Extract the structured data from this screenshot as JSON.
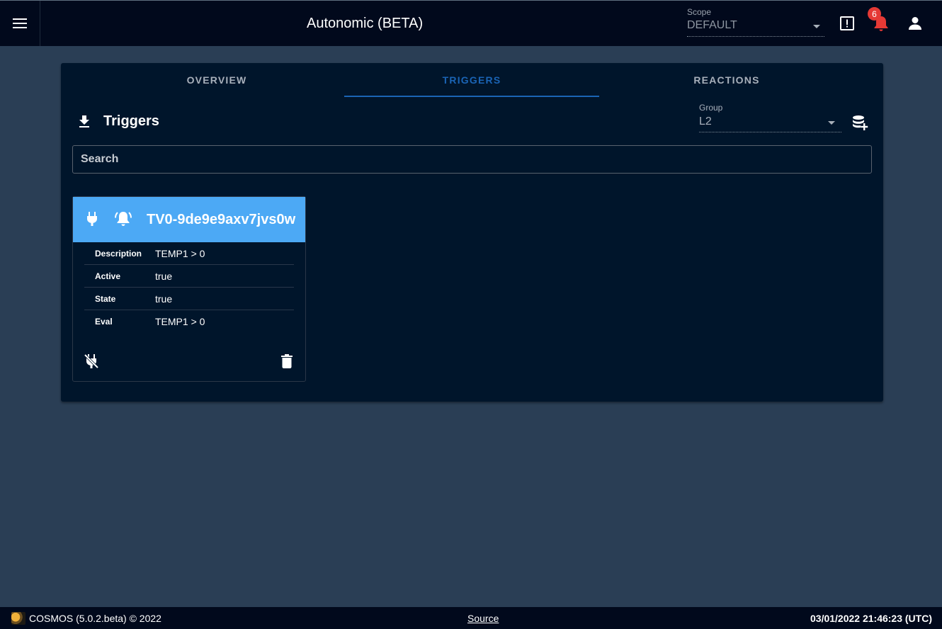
{
  "header": {
    "title": "Autonomic (BETA)",
    "scope_label": "Scope",
    "scope_value": "DEFAULT",
    "notification_count": "6"
  },
  "tabs": [
    {
      "label": "OVERVIEW",
      "active": false
    },
    {
      "label": "TRIGGERS",
      "active": true
    },
    {
      "label": "REACTIONS",
      "active": false
    }
  ],
  "triggers": {
    "title": "Triggers",
    "group_label": "Group",
    "group_value": "L2",
    "search_placeholder": "Search"
  },
  "trigger_card": {
    "name": "TV0-9de9e9axv7jvs0w",
    "header_color": "#4ca9f5",
    "rows": [
      {
        "key": "Description",
        "value": "TEMP1 > 0"
      },
      {
        "key": "Active",
        "value": "true"
      },
      {
        "key": "State",
        "value": "true"
      },
      {
        "key": "Eval",
        "value": "TEMP1 > 0"
      }
    ]
  },
  "footer": {
    "app": "COSMOS (5.0.2.beta) © 2022",
    "source": "Source",
    "datetime": "03/01/2022 21:46:23 (UTC)"
  },
  "colors": {
    "app_bar": "#01091c",
    "page_background": "#2a3e55",
    "panel": "#00152b",
    "active_tab": "#1a64b5",
    "badge": "#e53935"
  }
}
